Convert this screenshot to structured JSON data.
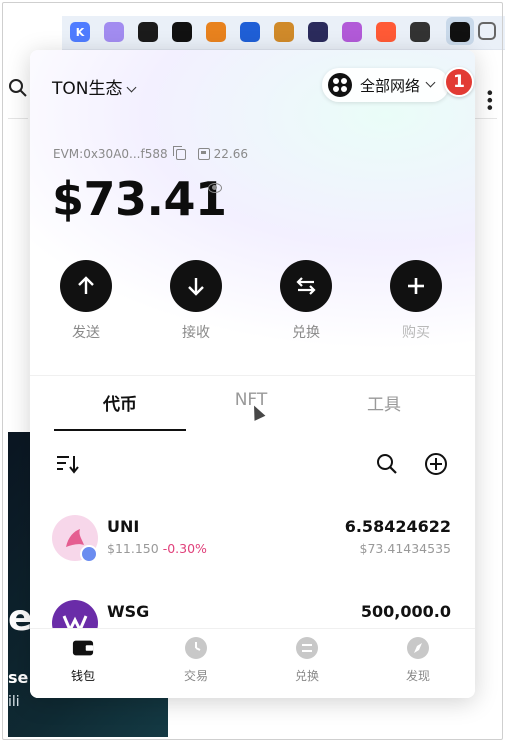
{
  "browser": {
    "extensions": [
      {
        "name": "k-extension-icon",
        "letter": "K",
        "color": "#4f7cff"
      },
      {
        "name": "ghost-extension-icon",
        "letter": "",
        "color": "#a28cf0"
      },
      {
        "name": "hex-extension-icon",
        "letter": "",
        "color": "#1b1b1b"
      },
      {
        "name": "dice-extension-icon",
        "letter": "",
        "color": "#111111"
      },
      {
        "name": "metamask-extension-icon",
        "letter": "",
        "color": "#e8821e"
      },
      {
        "name": "shield-extension-icon",
        "letter": "",
        "color": "#1f5fd6"
      },
      {
        "name": "coin-extension-icon",
        "letter": "",
        "color": "#d08a2a"
      },
      {
        "name": "cloud-extension-icon",
        "letter": "",
        "color": "#2b2b5c"
      },
      {
        "name": "robot-extension-icon",
        "letter": "",
        "color": "#b25ad8"
      },
      {
        "name": "a-extension-icon",
        "letter": "",
        "color": "#ff5a36"
      },
      {
        "name": "pointer-extension-icon",
        "letter": "",
        "color": "#333333"
      },
      {
        "name": "active-wallet-extension-icon",
        "letter": "",
        "color": "#111111"
      },
      {
        "name": "puzzle-extension-icon",
        "letter": "",
        "color": "#666666"
      }
    ],
    "background_partial_text": [
      "e",
      "se",
      "ili"
    ]
  },
  "wallet": {
    "network_title": "TON生态",
    "network_selector_label": "全部网络",
    "badge_number": "1",
    "address": "EVM:0x30A0...f588",
    "gas_value": "22.66",
    "balance": "$73.41",
    "actions": [
      {
        "label": "发送",
        "icon": "arrow-up-icon"
      },
      {
        "label": "接收",
        "icon": "arrow-down-icon"
      },
      {
        "label": "兑换",
        "icon": "swap-icon"
      },
      {
        "label": "购买",
        "icon": "plus-icon"
      }
    ],
    "tabs": [
      {
        "label": "代币",
        "active": true
      },
      {
        "label": "NFT",
        "active": false
      },
      {
        "label": "工具",
        "active": false
      }
    ],
    "tokens": [
      {
        "symbol": "UNI",
        "price": "$11.150",
        "change": "-0.30%",
        "amount": "6.58424622",
        "value": "$73.41434535",
        "logo_color": "#f7d7ea"
      },
      {
        "symbol": "WSG",
        "price": "",
        "change": "",
        "amount": "500,000.0",
        "value": "",
        "logo_color": "#6a2ca8"
      }
    ],
    "bottom_nav": [
      {
        "label": "钱包",
        "icon": "wallet-icon",
        "active": true
      },
      {
        "label": "交易",
        "icon": "clock-icon",
        "active": false
      },
      {
        "label": "兑换",
        "icon": "swap-nav-icon",
        "active": false
      },
      {
        "label": "发现",
        "icon": "compass-icon",
        "active": false
      }
    ],
    "colors": {
      "accent": "#111111",
      "negative": "#e0407a",
      "badge": "#e23b34"
    }
  }
}
